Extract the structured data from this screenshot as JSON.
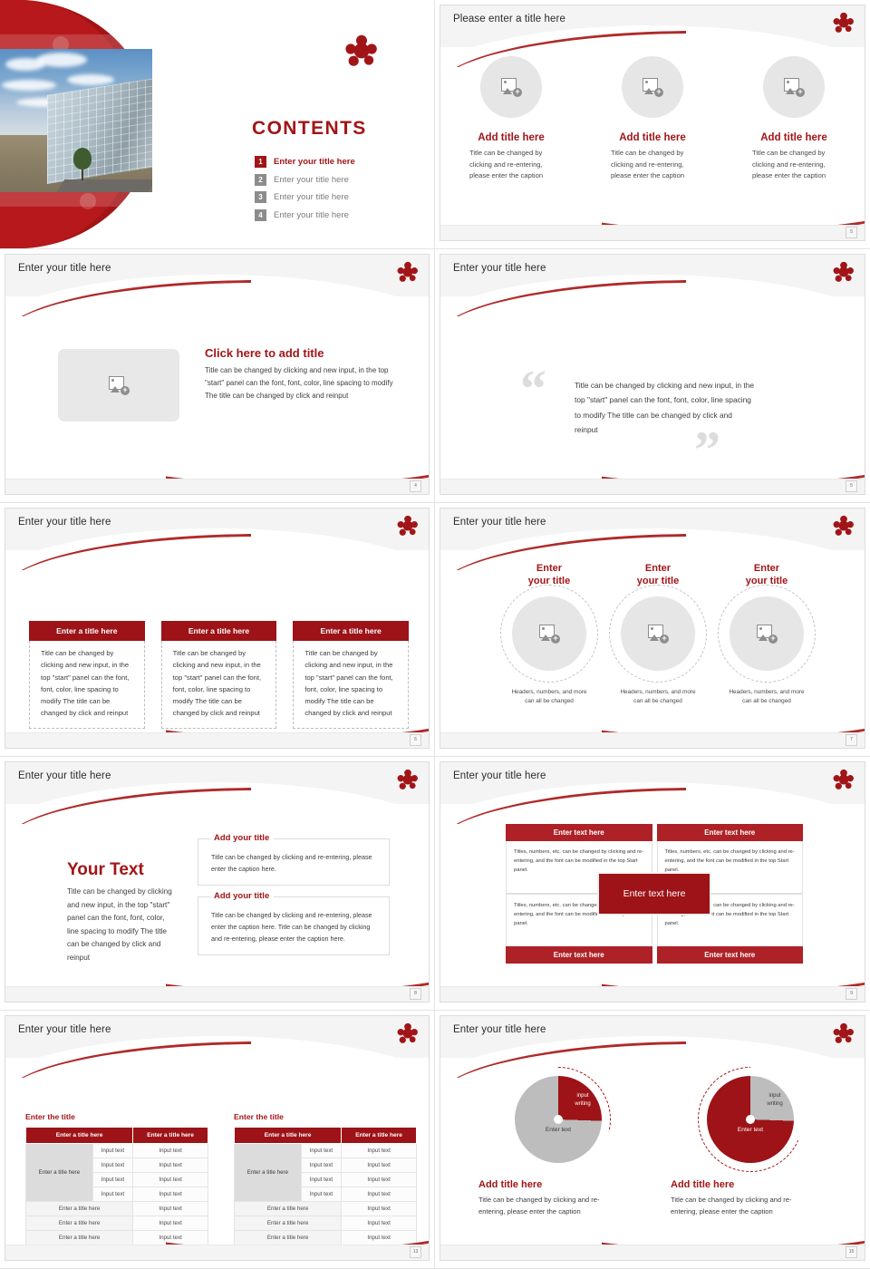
{
  "theme": {
    "primary_red": "#A11518",
    "dark_red": "#9D1317",
    "accent_red": "#AE2126",
    "grey": "#BDBDBD",
    "light_grey": "#E6E6E6"
  },
  "slides": [
    {
      "num": "",
      "kind": "cover",
      "title": "CONTENTS",
      "contents": [
        {
          "num": "1",
          "label": "Enter your title here",
          "active": true
        },
        {
          "num": "2",
          "label": "Enter your title here",
          "active": false
        },
        {
          "num": "3",
          "label": "Enter your title here",
          "active": false
        },
        {
          "num": "4",
          "label": "Enter your title here",
          "active": false
        }
      ]
    },
    {
      "num": "5",
      "kind": "three-circles",
      "title": "Please enter a title here",
      "columns": [
        {
          "heading": "Add title here",
          "body": "Title can be changed by clicking and re-entering, please enter the caption"
        },
        {
          "heading": "Add title here",
          "body": "Title can be changed by clicking and re-entering, please enter the caption"
        },
        {
          "heading": "Add title here",
          "body": "Title can be changed by clicking and re-entering, please enter the caption"
        }
      ]
    },
    {
      "num": "4",
      "kind": "image-text",
      "title": "Enter your title here",
      "heading": "Click here to add title",
      "body": "Title can be changed by clicking and new input, in the top \"start\" panel can the font, font, color, line spacing to modify The title can be changed by click and reinput"
    },
    {
      "num": "5",
      "kind": "quote",
      "title": "Enter your title here",
      "quote": "Title can be changed by clicking and new input, in the top \"start\" panel can the font, font, color, line spacing to modify The title can be changed by click and reinput",
      "quote_open": "“",
      "quote_close": "”"
    },
    {
      "num": "6",
      "kind": "three-cards",
      "title": "Enter your title here",
      "cards": [
        {
          "head": "Enter a title here",
          "body": "Title can be changed by clicking and new input, in the top \"start\" panel can the font, font, color, line spacing to modify The title can be changed by click and reinput"
        },
        {
          "head": "Enter a title here",
          "body": "Title can be changed by clicking and new input, in the top \"start\" panel can the font, font, color, line spacing to modify The title can be changed by click and reinput"
        },
        {
          "head": "Enter a title here",
          "body": "Title can be changed by clicking and new input, in the top \"start\" panel can the font, font, color, line spacing to modify The title can be changed by click and reinput"
        }
      ]
    },
    {
      "num": "7",
      "kind": "ring-circles",
      "title": "Enter your title here",
      "columns": [
        {
          "heading": "Enter\nyour title",
          "caption": "Headers, numbers, and more\ncan all be changed"
        },
        {
          "heading": "Enter\nyour title",
          "caption": "Headers, numbers, and more\ncan all be changed"
        },
        {
          "heading": "Enter\nyour title",
          "caption": "Headers, numbers, and more\ncan all be changed"
        }
      ]
    },
    {
      "num": "8",
      "kind": "your-text",
      "title": "Enter your title here",
      "big_heading": "Your Text",
      "big_body": "Title can be changed by clicking and new input, in the top \"start\" panel can the font, font, color, line spacing to modify The title can be changed by click and reinput",
      "boxes": [
        {
          "head": "Add your title",
          "body": "Title can be changed by clicking and re-entering, please enter the caption here."
        },
        {
          "head": "Add your title",
          "body": "Title can be changed by clicking and re-entering, please enter the caption here. Title can be changed by clicking and re-entering, please enter the caption here."
        }
      ]
    },
    {
      "num": "9",
      "kind": "four-boxes",
      "title": "Enter your title here",
      "center_label": "Enter text here",
      "quadrants": [
        {
          "bar": "Enter text here",
          "body": "Titles, numbers, etc. can be changed by clicking and re-entering, and the font can be modified in the top Start panel."
        },
        {
          "bar": "Enter text here",
          "body": "Titles, numbers, etc. can be changed by clicking and re-entering, and the font can be modified in the top Start panel."
        },
        {
          "bar": "Enter text here",
          "body": "Titles, numbers, etc. can be changed by clicking and re-entering, and the font can be modified in the top Start panel."
        },
        {
          "bar": "Enter text here",
          "body": "Titles, numbers, etc. can be changed by clicking and re-entering, and the font can be modified in the top Start panel."
        }
      ]
    },
    {
      "num": "13",
      "kind": "tables",
      "title": "Enter your title here",
      "tables": [
        {
          "caption": "Enter the title",
          "headers": [
            "Enter a title here",
            "Enter a title here"
          ],
          "row_group_label": "Enter a title here",
          "group_rows": [
            [
              "Input text",
              "Input text"
            ],
            [
              "Input text",
              "Input text"
            ],
            [
              "Input text",
              "Input text"
            ],
            [
              "Input text",
              "Input text"
            ]
          ],
          "footer_rows": [
            [
              "Enter a title here",
              "Input text"
            ],
            [
              "Enter a title here",
              "Input text"
            ],
            [
              "Enter a title here",
              "Input text"
            ]
          ]
        },
        {
          "caption": "Enter the title",
          "headers": [
            "Enter a title here",
            "Enter a title here"
          ],
          "row_group_label": "Enter a title here",
          "group_rows": [
            [
              "Input text",
              "Input text"
            ],
            [
              "Input text",
              "Input text"
            ],
            [
              "Input text",
              "Input text"
            ],
            [
              "Input text",
              "Input text"
            ]
          ],
          "footer_rows": [
            [
              "Enter a title here",
              "Input text"
            ],
            [
              "Enter a title here",
              "Input text"
            ],
            [
              "Enter a title here",
              "Input text"
            ]
          ]
        }
      ]
    },
    {
      "num": "15",
      "kind": "pies",
      "title": "Enter your title here",
      "charts": [
        {
          "slice_label": "input\nwriting",
          "rest_label": "Enter text",
          "heading": "Add title here",
          "body": "Title can be changed by clicking and re-entering, please enter the caption"
        },
        {
          "slice_label": "input\nwriting",
          "rest_label": "Enter text",
          "heading": "Add title here",
          "body": "Title can be changed by clicking and re-entering, please enter the caption"
        }
      ]
    }
  ],
  "chart_data": [
    {
      "type": "pie",
      "title": "Add title here",
      "labels": [
        "input writing",
        "Enter text"
      ],
      "values": [
        25.5,
        74.5
      ],
      "colors": [
        "#9D1317",
        "#BDBDBD"
      ]
    },
    {
      "type": "pie",
      "title": "Add title here",
      "labels": [
        "input writing",
        "Enter text"
      ],
      "values": [
        25.5,
        74.5
      ],
      "colors": [
        "#BDBDBD",
        "#9D1317"
      ]
    }
  ]
}
